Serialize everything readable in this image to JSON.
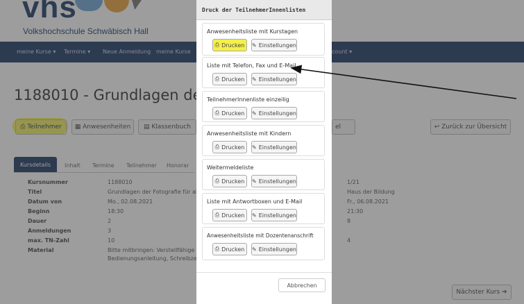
{
  "header": {
    "logo_text": "vhs",
    "subtitle": "Volkshochschule Schwäbisch Hall"
  },
  "nav": {
    "items": [
      "meine Kurse ▾",
      "Termine ▾",
      "Neue Anmeldung",
      "meine Kurse",
      "count ▾"
    ]
  },
  "page": {
    "title": "1188010 - Grundlagen der Fotogra"
  },
  "toolbar": {
    "buttons": [
      "Teilnehmer",
      "Anwesenheiten",
      "Klassenbuch",
      "el",
      "Zurück zur Übersicht"
    ]
  },
  "tabs": {
    "active": "Kursdetails",
    "items": [
      "Inhalt",
      "Termine",
      "Teilnehmer",
      "Honorar"
    ]
  },
  "details": {
    "rows": [
      {
        "label": "Kursnummer",
        "value": "1188010"
      },
      {
        "label": "Titel",
        "value": "Grundlagen der Fotografie für alle"
      },
      {
        "label": "Datum von",
        "value": "Mo., 02.08.2021"
      },
      {
        "label": "Beginn",
        "value": "18:30"
      },
      {
        "label": "Dauer",
        "value": "2"
      },
      {
        "label": "Anmeldungen",
        "value": "3"
      },
      {
        "label": "max. TN-Zahl",
        "value": "10"
      },
      {
        "label": "Material",
        "value": "Bitte mitbringen: Verstellfähige De"
      },
      {
        "label": "",
        "value": "Bedienungsanleitung, Schreibzeug"
      }
    ],
    "right_values": [
      "1/21",
      "Haus der Bildung",
      "Fr., 06.08.2021",
      "21:30",
      "8",
      "",
      "4"
    ]
  },
  "next_button": "Nächster Kurs ➔",
  "modal": {
    "title": "Druck der TeilnehmerInnenlisten",
    "print_label": "Drucken",
    "settings_label": "Einstellungen",
    "cards": [
      "Anwesenheitsliste mit Kurstagen",
      "Liste mit Telefon, Fax und E-Mail",
      "TeilnehmerInnenliste einzeilig",
      "Anwesenheitsliste mit Kindern",
      "Weitermeldeliste",
      "Liste mit Antwortboxen und E-Mail",
      "Anwesenheitsliste mit Dozentenanschrift"
    ],
    "cancel_label": "Abbrechen"
  },
  "colors": {
    "navbar": "#1f3a66",
    "highlight": "#f4f04a"
  }
}
